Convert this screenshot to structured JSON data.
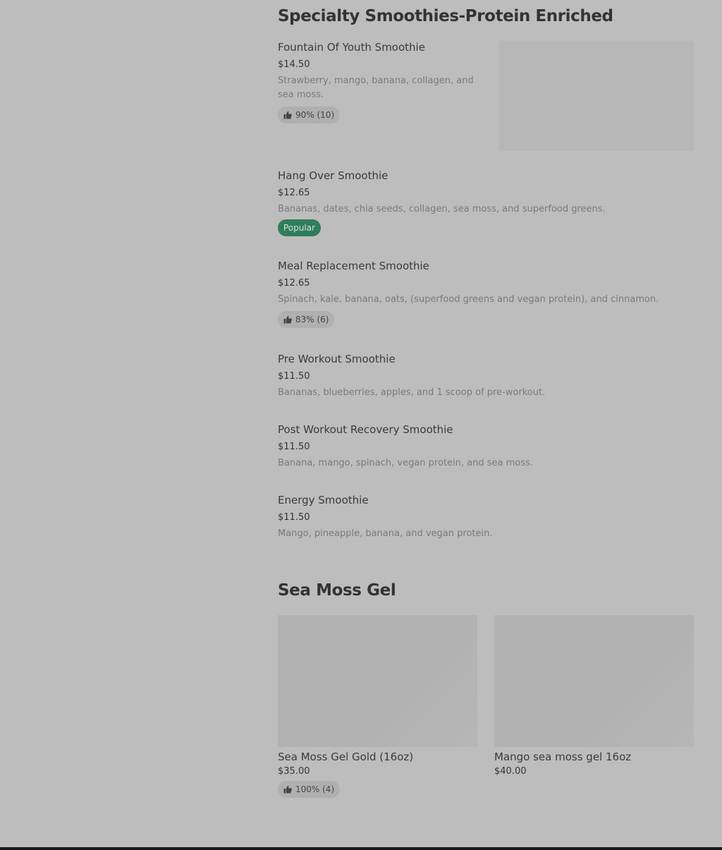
{
  "sections": {
    "smoothies": {
      "title": "Specialty Smoothies-Protein Enriched",
      "items": [
        {
          "name": "Fountain Of Youth Smoothie",
          "price": "$14.50",
          "description": "Strawberry, mango, banana, collagen, and sea moss.",
          "rating": "90% (10)"
        },
        {
          "name": "Hang Over Smoothie",
          "price": "$12.65",
          "description": "Bananas, dates, chia seeds, collagen, sea moss, and superfood greens.",
          "badge": "Popular"
        },
        {
          "name": "Meal Replacement Smoothie",
          "price": "$12.65",
          "description": "Spinach, kale, banana, oats, (superfood greens and vegan protein), and cinnamon.",
          "rating": "83% (6)"
        },
        {
          "name": "Pre Workout Smoothie",
          "price": "$11.50",
          "description": "Bananas, blueberries, apples, and 1 scoop of pre-workout."
        },
        {
          "name": "Post Workout Recovery Smoothie",
          "price": "$11.50",
          "description": "Banana, mango, spinach, vegan protein, and sea moss."
        },
        {
          "name": "Energy Smoothie",
          "price": "$11.50",
          "description": "Mango, pineapple, banana, and vegan protein."
        }
      ]
    },
    "sea_moss": {
      "title": "Sea Moss Gel",
      "items": [
        {
          "name": "Sea Moss Gel Gold (16oz)",
          "price": "$35.00",
          "rating": "100% (4)"
        },
        {
          "name": "Mango sea moss gel 16oz",
          "price": "$40.00"
        }
      ]
    }
  },
  "icons": {
    "rating": "thumbs-up-icon"
  },
  "colors": {
    "background": "#bdbdbd",
    "popular_badge": "#2f7d5a",
    "rating_pill": "#b0b0b0"
  }
}
